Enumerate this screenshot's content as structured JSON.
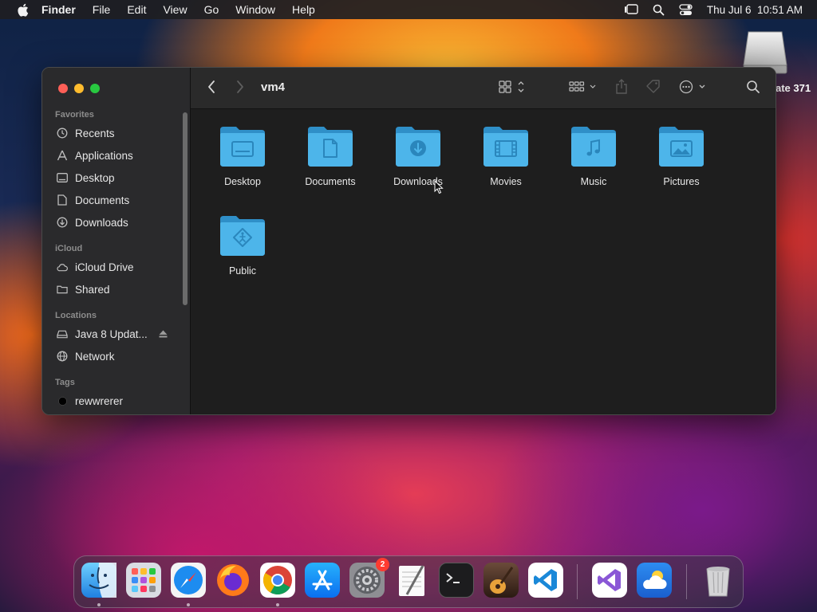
{
  "menubar": {
    "app_name": "Finder",
    "menus": [
      "File",
      "Edit",
      "View",
      "Go",
      "Window",
      "Help"
    ],
    "clock": "Thu Jul 6  10:51 AM"
  },
  "desktop": {
    "drive_label": "ate 371"
  },
  "window": {
    "title": "vm4",
    "sidebar": {
      "favorites_header": "Favorites",
      "favorites": [
        {
          "label": "Recents",
          "icon": "clock-icon"
        },
        {
          "label": "Applications",
          "icon": "applications-icon"
        },
        {
          "label": "Desktop",
          "icon": "desktop-icon"
        },
        {
          "label": "Documents",
          "icon": "document-icon"
        },
        {
          "label": "Downloads",
          "icon": "download-icon"
        }
      ],
      "icloud_header": "iCloud",
      "icloud": [
        {
          "label": "iCloud Drive",
          "icon": "cloud-icon"
        },
        {
          "label": "Shared",
          "icon": "shared-folder-icon"
        }
      ],
      "locations_header": "Locations",
      "locations": [
        {
          "label": "Java 8 Updat...",
          "icon": "drive-icon"
        },
        {
          "label": "Network",
          "icon": "globe-icon"
        }
      ],
      "tags_header": "Tags",
      "tags": [
        {
          "label": "rewwrerer",
          "color": "#000000"
        }
      ]
    },
    "folders": [
      {
        "label": "Desktop",
        "glyph": "desktop"
      },
      {
        "label": "Documents",
        "glyph": "document"
      },
      {
        "label": "Downloads",
        "glyph": "download"
      },
      {
        "label": "Movies",
        "glyph": "film"
      },
      {
        "label": "Music",
        "glyph": "music"
      },
      {
        "label": "Pictures",
        "glyph": "picture"
      },
      {
        "label": "Public",
        "glyph": "public"
      }
    ]
  },
  "dock": {
    "apps": [
      {
        "name": "Finder",
        "icon": "finder-icon"
      },
      {
        "name": "Launchpad",
        "icon": "launchpad-icon"
      },
      {
        "name": "Safari",
        "icon": "safari-icon"
      },
      {
        "name": "Firefox",
        "icon": "firefox-icon"
      },
      {
        "name": "Chrome",
        "icon": "chrome-icon"
      },
      {
        "name": "App Store",
        "icon": "app-store-icon"
      },
      {
        "name": "System Settings",
        "icon": "settings-icon",
        "badge": "2"
      },
      {
        "name": "TextEdit",
        "icon": "textedit-icon"
      },
      {
        "name": "Terminal",
        "icon": "terminal-icon"
      },
      {
        "name": "GarageBand",
        "icon": "guitar-icon"
      },
      {
        "name": "Visual Studio Code",
        "icon": "vscode-icon"
      },
      {
        "name": "Visual Studio",
        "icon": "visual-studio-icon"
      },
      {
        "name": "Weather",
        "icon": "weather-icon"
      },
      {
        "name": "Trash",
        "icon": "trash-icon"
      }
    ]
  },
  "colors": {
    "folder_blue": "#3aa7dc",
    "traffic_red": "#fe5f57",
    "traffic_yellow": "#febc2e",
    "traffic_green": "#28c840",
    "badge_red": "#ff3b30"
  }
}
